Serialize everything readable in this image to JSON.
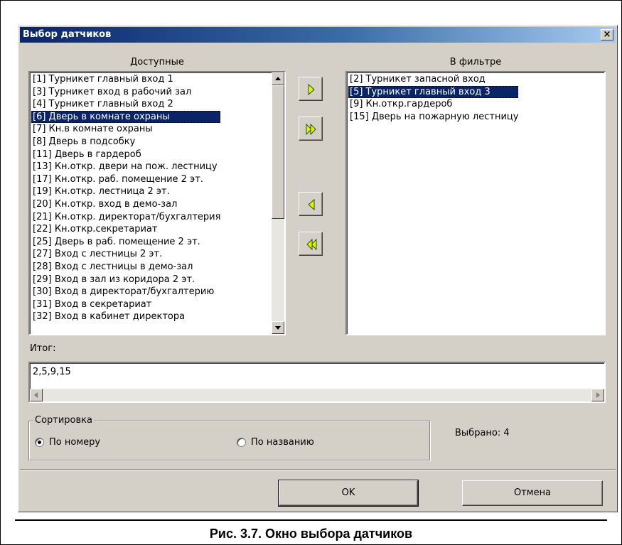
{
  "window": {
    "title": "Выбор датчиков",
    "close_symbol": "×"
  },
  "available": {
    "caption": "Доступные",
    "items": [
      "[1]  Турникет главный вход 1",
      "[3]  Турникет вход в рабочий зал",
      "[4]  Турникет главный вход 2",
      "[6]  Дверь в комнате охраны",
      "[7]  Кн.в комнате охраны",
      "[8]  Дверь в подсобку",
      "[11]  Дверь в гардероб",
      "[13]  Кн.откр. двери на пож. лестницу",
      "[17]  Кн.откр. раб. помещение 2 эт.",
      "[19]  Кн.откр. лестница 2 эт.",
      "[20]  Кн.откр. вход в демо-зал",
      "[21]  Кн.откр. директорат/бухгалтерия",
      "[22]  Кн.откр.секретариат",
      "[25]  Дверь в раб. помещение 2 эт.",
      "[27]  Вход с лестницы 2 эт.",
      "[28]  Вход с лестницы в демо-зал",
      "[29]  Вход в зал из коридора 2 эт.",
      "[30]  Вход в директорат/бухгалтерию",
      "[31]  Вход в секретариат",
      "[32]  Вход в кабинет директора"
    ],
    "selected_index": 3
  },
  "filter": {
    "caption": "В фильтре",
    "items": [
      "[2]  Турникет запасной вход",
      "[5]  Турникет главный вход 3",
      "[9]  Кн.откр.гардероб",
      "[15]  Дверь на пожарную лестницу"
    ],
    "selected_index": 1
  },
  "icons": {
    "add_one": "arrow-right-icon",
    "add_all": "double-arrow-right-icon",
    "remove_one": "arrow-left-icon",
    "remove_all": "double-arrow-left-icon",
    "arrow_fill": "#e8f000",
    "arrow_stroke": "#1a5a1a"
  },
  "total": {
    "label": "Итог:",
    "value": "2,5,9,15"
  },
  "sorting": {
    "legend": "Сортировка",
    "options": [
      "По номеру",
      "По названию"
    ],
    "selected_index": 0
  },
  "selected_count": "Выбрано: 4",
  "buttons": {
    "ok": "OK",
    "cancel": "Отмена"
  },
  "figure_caption": "Рис. 3.7. Окно выбора датчиков"
}
